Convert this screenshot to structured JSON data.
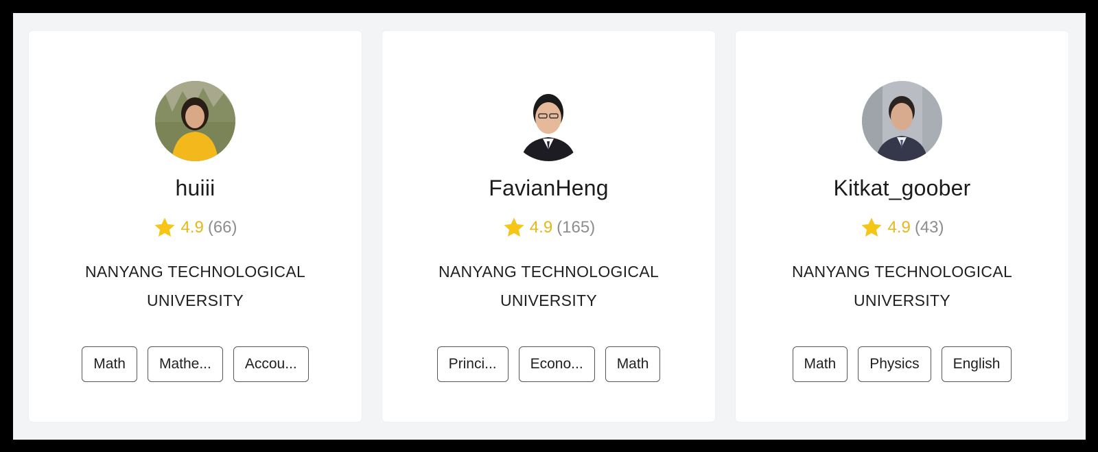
{
  "colors": {
    "background": "#f3f4f5",
    "card": "#ffffff",
    "star": "#f5c518",
    "rating_score": "#e5b81a",
    "rating_count": "#8d8d8d",
    "tag_border": "#555555"
  },
  "tutors": [
    {
      "name": "huiii",
      "avatar_icon": "profile-photo",
      "rating": "4.9",
      "reviews": "(66)",
      "school": "NANYANG TECHNOLOGICAL UNIVERSITY",
      "subjects": [
        "Math",
        "Mathe...",
        "Accou..."
      ]
    },
    {
      "name": "FavianHeng",
      "avatar_icon": "profile-photo",
      "rating": "4.9",
      "reviews": "(165)",
      "school": "NANYANG TECHNOLOGICAL UNIVERSITY",
      "subjects": [
        "Princi...",
        "Econo...",
        "Math"
      ]
    },
    {
      "name": "Kitkat_goober",
      "avatar_icon": "profile-photo",
      "rating": "4.9",
      "reviews": "(43)",
      "school": "NANYANG TECHNOLOGICAL UNIVERSITY",
      "subjects": [
        "Math",
        "Physics",
        "English"
      ]
    }
  ]
}
